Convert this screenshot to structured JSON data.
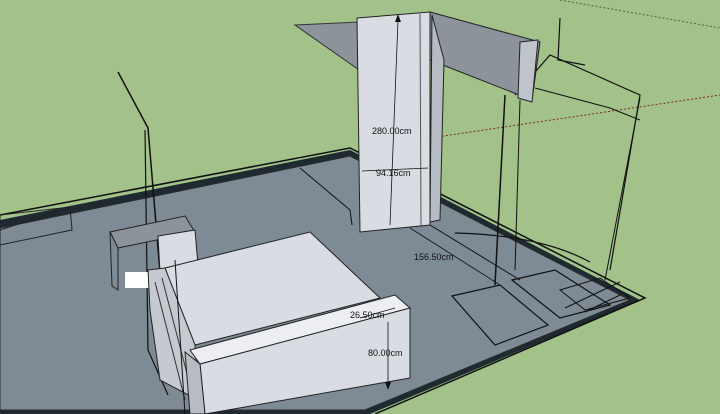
{
  "viewport": {
    "sky_color": "#a2c28a",
    "ground_color": "#a2c28a"
  },
  "model": {
    "floor_color": "#7e8a94",
    "wall_face_color": "#d9dde3",
    "wall_side_color": "#b7bcc4",
    "edge_color": "#1a1a1a"
  },
  "dimensions": {
    "wall_height": "280.00cm",
    "wall_width": "94.16cm",
    "floor_span": "156.50cm",
    "box_depth": "26.50cm",
    "box_height": "80.00cm"
  }
}
